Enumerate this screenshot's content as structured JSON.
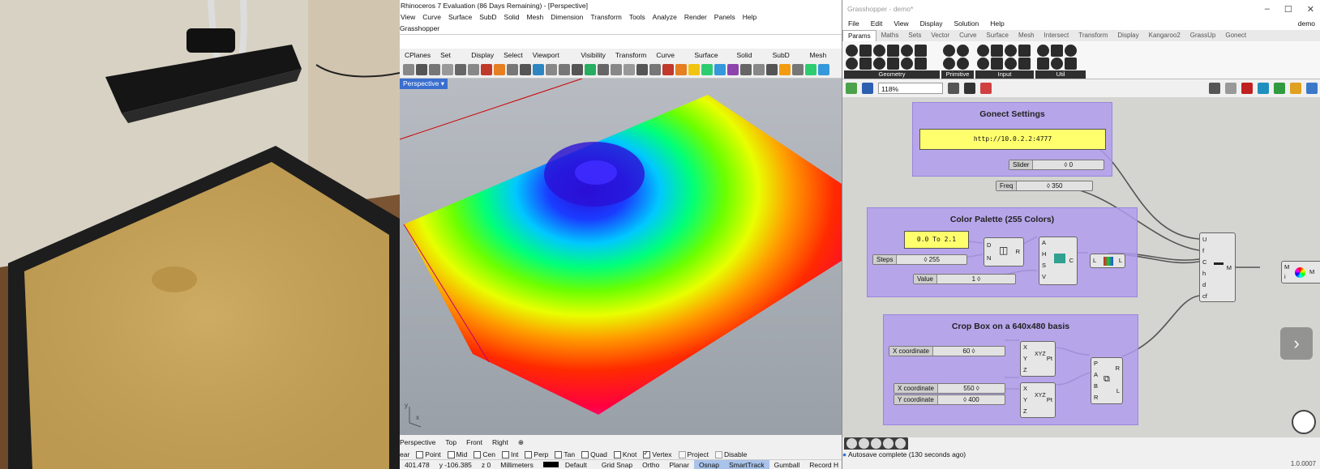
{
  "rhino": {
    "title": "Rhinoceros 7 Evaluation (86 Days Remaining) - [Perspective]",
    "menu": [
      "View",
      "Curve",
      "Surface",
      "SubD",
      "Solid",
      "Mesh",
      "Dimension",
      "Transform",
      "Tools",
      "Analyze",
      "Render",
      "Panels",
      "Help"
    ],
    "command_line": "Grasshopper",
    "toolbar_tabs": [
      "CPlanes",
      "Set View",
      "Display",
      "Select",
      "Viewport Layout",
      "Visibility",
      "Transform",
      "Curve Tools",
      "Surface Tools",
      "Solid Tools",
      "SubD Tools",
      "Mesh Tools"
    ],
    "viewport_label": "Perspective",
    "axis_labels": {
      "y": "y",
      "x": "x"
    },
    "viewport_tabs": [
      "Perspective",
      "Top",
      "Front",
      "Right"
    ],
    "osnaps": [
      {
        "label": "ear",
        "checked": false
      },
      {
        "label": "Point",
        "checked": false
      },
      {
        "label": "Mid",
        "checked": false
      },
      {
        "label": "Cen",
        "checked": false
      },
      {
        "label": "Int",
        "checked": false
      },
      {
        "label": "Perp",
        "checked": false
      },
      {
        "label": "Tan",
        "checked": false
      },
      {
        "label": "Quad",
        "checked": false
      },
      {
        "label": "Knot",
        "checked": false
      },
      {
        "label": "Vertex",
        "checked": true
      },
      {
        "label": "Project",
        "checked": false
      },
      {
        "label": "Disable",
        "checked": false
      }
    ],
    "status": {
      "x": "401.478",
      "y": "y -106.385",
      "z": "z 0",
      "units": "Millimeters",
      "layer": "Default",
      "items": [
        "Grid Snap",
        "Ortho",
        "Planar",
        "Osnap",
        "SmartTrack",
        "Gumball",
        "Record H"
      ]
    }
  },
  "gh": {
    "title": "Grasshopper - demo*",
    "menu": [
      "File",
      "Edit",
      "View",
      "Display",
      "Solution",
      "Help"
    ],
    "doc_name": "demo",
    "tabs": [
      "Params",
      "Maths",
      "Sets",
      "Vector",
      "Curve",
      "Surface",
      "Mesh",
      "Intersect",
      "Transform",
      "Display",
      "Kangaroo2",
      "GrassUp",
      "Gonect"
    ],
    "ribbon_groups": [
      "Geometry",
      "Primitive",
      "Input",
      "Util"
    ],
    "zoom": "118%",
    "groups": {
      "settings": "Gonect Settings",
      "palette": "Color Palette (255 Colors)",
      "crop": "Crop Box on a 640x480 basis"
    },
    "url_panel": "http://10.0.2.2:4777",
    "range_panel": "0.0 To 2.1",
    "sliders": {
      "slider": {
        "name": "Slider",
        "value": "0"
      },
      "freq": {
        "name": "Freq",
        "value": "350"
      },
      "steps": {
        "name": "Steps",
        "value": "255"
      },
      "value": {
        "name": "Value",
        "value": "1"
      },
      "xcoord1": {
        "name": "X coordinate",
        "value": "60"
      },
      "xcoord2": {
        "name": "X coordinate",
        "value": "550"
      },
      "ycoord2": {
        "name": "Y coordinate",
        "value": "400"
      }
    },
    "pins": {
      "range_in": [
        "D",
        "N"
      ],
      "range_out": "R",
      "hsv_in": [
        "A",
        "H",
        "S",
        "V"
      ],
      "hsv_out": "C",
      "gradient_in": "L",
      "gradient_out": "L",
      "kinect_in": [
        "U",
        "f",
        "C",
        "h",
        "d",
        "cf"
      ],
      "kinect_out": "M",
      "pt_in": [
        "X",
        "Y",
        "Z"
      ],
      "pt_out": "Pt",
      "box_in": [
        "P",
        "A",
        "B",
        "R"
      ],
      "box_out": [
        "R",
        "L"
      ],
      "mesh_in": [
        "M",
        "i"
      ],
      "mesh_out": "M"
    },
    "status": "Autosave complete (130 seconds ago)",
    "version": "1.0.0007"
  }
}
